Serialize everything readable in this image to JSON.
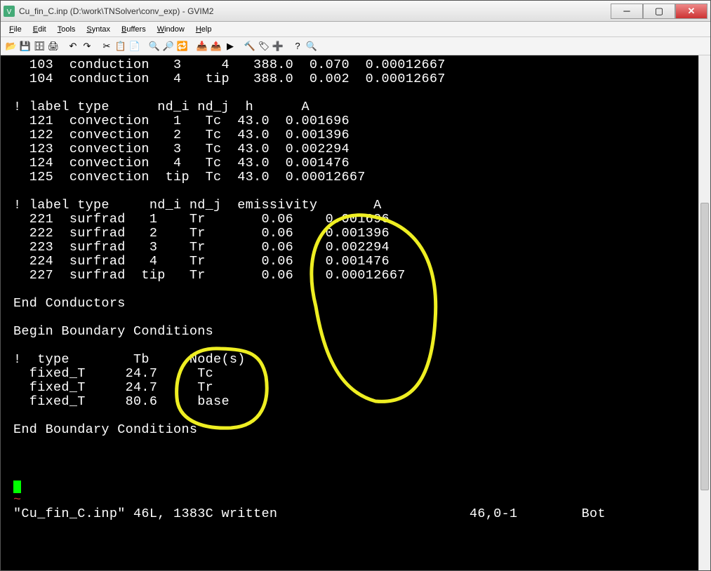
{
  "title": "Cu_fin_C.inp (D:\\work\\TNSolver\\conv_exp) - GVIM2",
  "menu": {
    "file": "File",
    "edit": "Edit",
    "tools": "Tools",
    "syntax": "Syntax",
    "buffers": "Buffers",
    "window": "Window",
    "help": "Help"
  },
  "editor": {
    "lines": [
      "  103  conduction   3     4   388.0  0.070  0.00012667",
      "  104  conduction   4   tip   388.0  0.002  0.00012667",
      "",
      "! label type      nd_i nd_j  h      A",
      "  121  convection   1   Tc  43.0  0.001696",
      "  122  convection   2   Tc  43.0  0.001396",
      "  123  convection   3   Tc  43.0  0.002294",
      "  124  convection   4   Tc  43.0  0.001476",
      "  125  convection  tip  Tc  43.0  0.00012667",
      "",
      "! label type     nd_i nd_j  emissivity       A",
      "  221  surfrad   1    Tr       0.06    0.001696",
      "  222  surfrad   2    Tr       0.06    0.001396",
      "  223  surfrad   3    Tr       0.06    0.002294",
      "  224  surfrad   4    Tr       0.06    0.001476",
      "  227  surfrad  tip   Tr       0.06    0.00012667",
      "",
      "End Conductors",
      "",
      "Begin Boundary Conditions",
      "",
      "!  type        Tb     Node(s)",
      "  fixed_T     24.7     Tc",
      "  fixed_T     24.7     Tr",
      "  fixed_T     80.6     base",
      "",
      "End Boundary Conditions"
    ],
    "tilde": "~",
    "status": "\"Cu_fin_C.inp\" 46L, 1383C written                        46,0-1        Bot"
  }
}
